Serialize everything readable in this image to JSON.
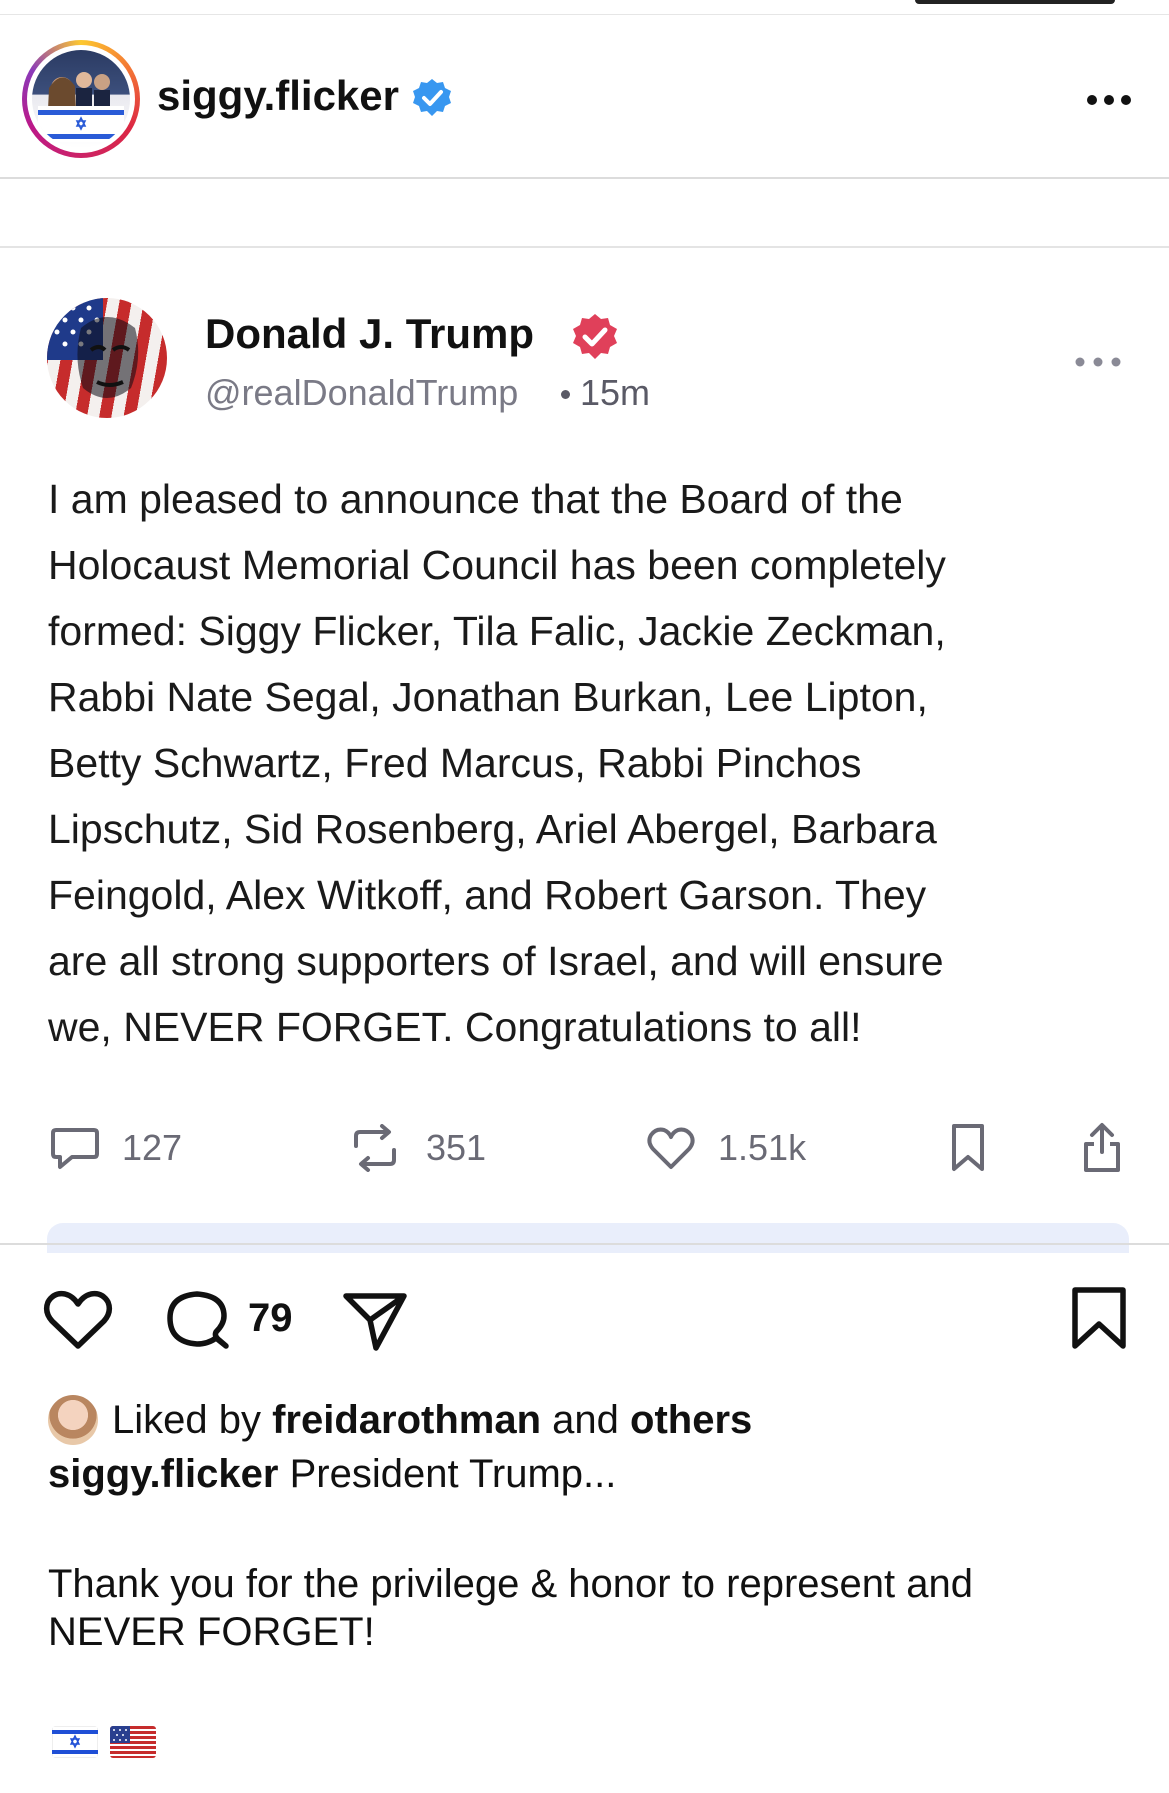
{
  "post": {
    "username": "siggy.flicker",
    "verified_icon": "verified-check-icon",
    "more_icon": "more-horizontal-icon"
  },
  "embedded_post": {
    "author_name": "Donald J. Trump",
    "handle": "@realDonaldTrump",
    "time": "15m",
    "body_lines": [
      "I am pleased to announce that the Board of the",
      "Holocaust Memorial Council has been completely",
      "formed: Siggy Flicker, Tila Falic, Jackie Zeckman,",
      "Rabbi Nate Segal, Jonathan Burkan, Lee Lipton,",
      "Betty Schwartz, Fred Marcus, Rabbi Pinchos",
      "Lipschutz, Sid Rosenberg, Ariel Abergel, Barbara",
      "Feingold, Alex Witkoff, and Robert Garson. They",
      "are all strong supporters of Israel, and will ensure",
      "we, NEVER FORGET. Congratulations to all!"
    ],
    "stats": {
      "replies": "127",
      "retruths": "351",
      "likes": "1.51k"
    }
  },
  "actions": {
    "comment_count": "79"
  },
  "likes": {
    "prefix": "Liked by",
    "user": "freidarothman",
    "middle": "and",
    "others": "others"
  },
  "caption": {
    "username": "siggy.flicker",
    "text": "President Trump...",
    "body_line1": "Thank you for the privilege & honor to represent and",
    "body_line2": "NEVER FORGET!"
  },
  "colors": {
    "verified_blue": "#3897f0",
    "truth_badge": "#e0405a",
    "muted": "#7a7a86"
  }
}
